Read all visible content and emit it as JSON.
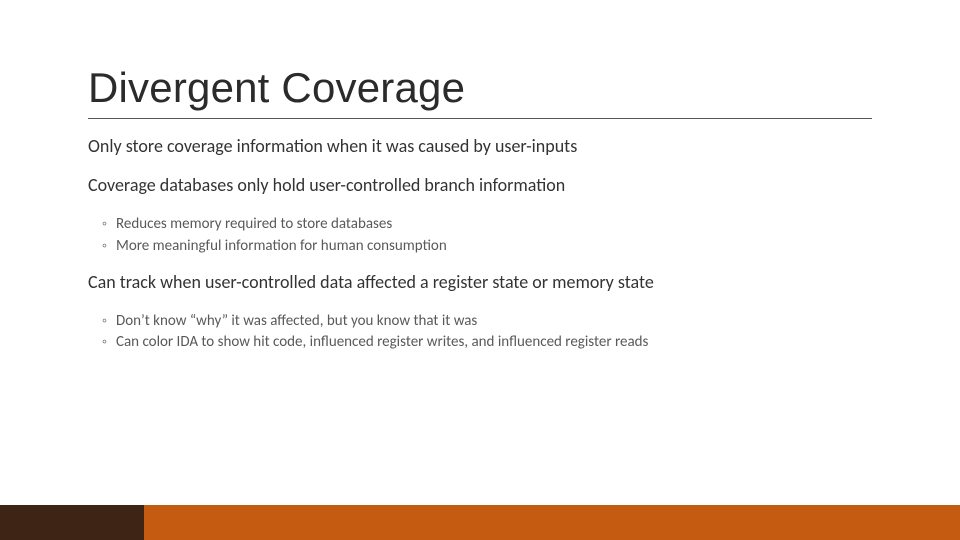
{
  "title": "Divergent Coverage",
  "section1": {
    "lead": "Only store coverage information when it was caused by user-inputs"
  },
  "section2": {
    "lead": "Coverage databases only hold user-controlled branch information",
    "items": [
      "Reduces memory required to store databases",
      "More meaningful information for human consumption"
    ]
  },
  "section3": {
    "lead": "Can track when user-controlled data affected a register state or memory state",
    "items": [
      "Don’t know “why” it was affected, but you know that it was",
      "Can color IDA to show hit code, influenced register writes, and influenced register reads"
    ]
  },
  "theme": {
    "bar_dark": "#3e2414",
    "bar_orange": "#c55a11"
  }
}
